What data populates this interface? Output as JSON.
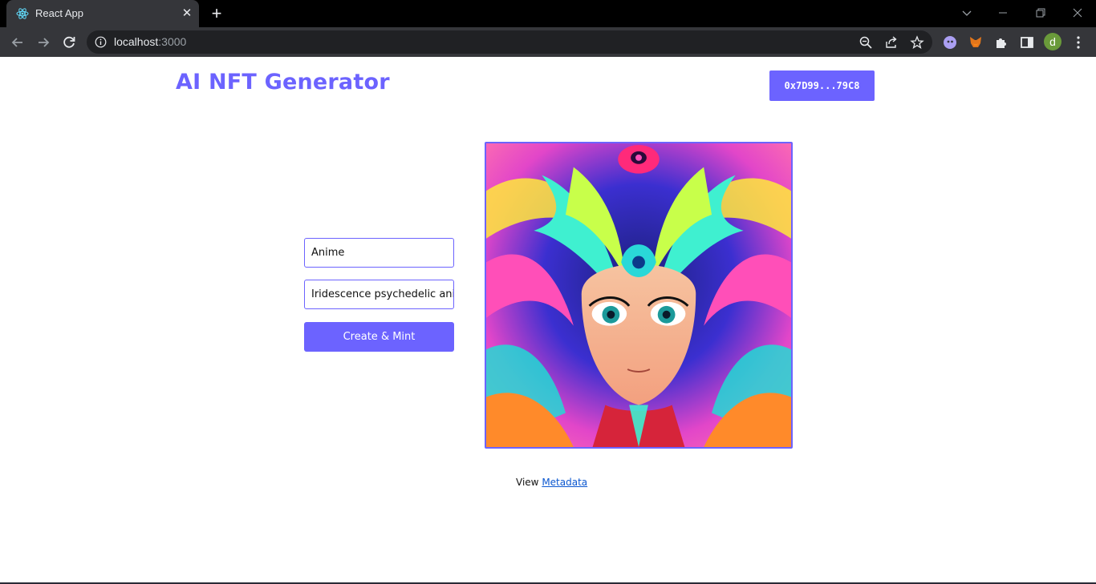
{
  "browser": {
    "tab_title": "React App",
    "tab_close": "✕",
    "new_tab": "+",
    "url_host": "localhost",
    "url_port": ":3000",
    "profile_initial": "d",
    "icons": [
      "react-favicon-icon",
      "back-icon",
      "forward-icon",
      "reload-icon",
      "info-icon",
      "zoom-icon",
      "share-icon",
      "bookmark-star-icon",
      "extension-ghost-icon",
      "metamask-icon",
      "puzzle-icon",
      "sidepanel-icon",
      "menu-kebab-icon",
      "tab-search-icon",
      "minimize-icon",
      "restore-icon",
      "close-window-icon"
    ]
  },
  "app": {
    "title": "AI NFT Generator",
    "wallet_button": "0x7D99...79C8",
    "name_input_value": "Anime",
    "description_input_value": "Iridescence psychedelic anime",
    "mint_button": "Create & Mint",
    "meta_prefix": "View",
    "meta_link": "Metadata",
    "accent_color": "#6c63ff"
  }
}
